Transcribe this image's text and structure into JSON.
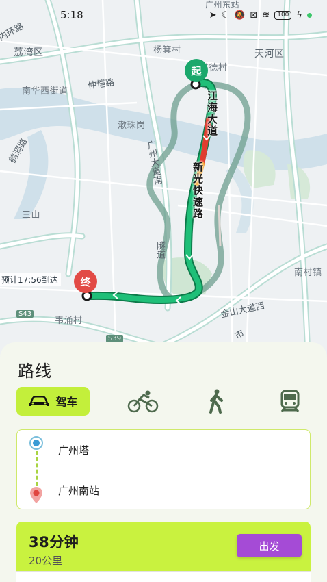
{
  "status_bar": {
    "time": "5:18",
    "battery": "100"
  },
  "map": {
    "labels": {
      "liwan": "荔湾区",
      "tianhe": "天河区",
      "yangji": "杨箕村",
      "liede": "猎德村",
      "nanhua": "南华西街道",
      "zhongkai": "仲恺路",
      "dunzhu": "漱珠岗",
      "shidong": "鹤洞路",
      "sanshan": "三山",
      "weichong": "韦涌村",
      "nancun": "南村镇",
      "jinshan": "金山大道西",
      "neihuan": "内环路",
      "guangzhou_dadao": "广州大道南",
      "sui_dao": "隧道",
      "shi": "市",
      "gzzhan": "广州东站",
      "s43": "S43",
      "s39": "S39"
    },
    "route_labels": {
      "jianghai": "江海大道",
      "xinguang": "新光快速路"
    },
    "start_pin": "起",
    "end_pin": "终",
    "eta": "预计17:56到达"
  },
  "panel": {
    "title": "路线",
    "modes": {
      "drive": "驾车",
      "bike": "bike-icon",
      "walk": "walk-icon",
      "transit": "train-icon"
    },
    "origin": "广州塔",
    "destination": "广州南站",
    "result": {
      "duration": "38分钟",
      "distance": "20公里",
      "go_label": "出发"
    }
  }
}
